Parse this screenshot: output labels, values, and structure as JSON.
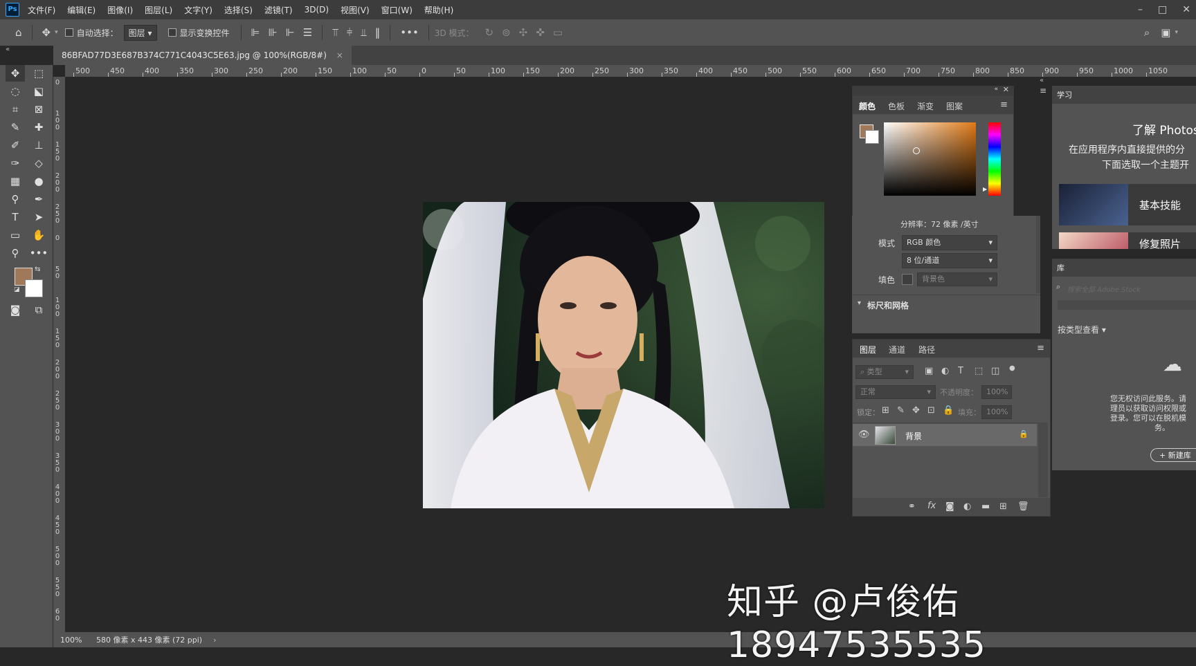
{
  "menubar": {
    "logo": "Ps",
    "items": [
      "文件(F)",
      "编辑(E)",
      "图像(I)",
      "图层(L)",
      "文字(Y)",
      "选择(S)",
      "滤镜(T)",
      "3D(D)",
      "视图(V)",
      "窗口(W)",
      "帮助(H)"
    ]
  },
  "options": {
    "auto_select_label": "自动选择：",
    "auto_select_value": "图层",
    "show_transform_label": "显示变换控件",
    "mode_3d_label": "3D 模式："
  },
  "document": {
    "tab_title": "86BFAD77D3E687B374C771C4043C5E63.jpg @ 100%(RGB/8#)",
    "tab_close": "×"
  },
  "ruler": {
    "h_labels": [
      "500",
      "450",
      "400",
      "350",
      "300",
      "250",
      "200",
      "150",
      "100",
      "50",
      "0",
      "50",
      "100",
      "150",
      "200",
      "250",
      "300",
      "350",
      "400",
      "450",
      "500",
      "550",
      "600",
      "650",
      "700",
      "750",
      "800",
      "850",
      "900",
      "950",
      "1000",
      "1050"
    ],
    "v_labels": [
      "0",
      "1 0 0",
      "1 5 0",
      "2 0 0",
      "2 5 0",
      "0",
      "5 0",
      "1 0 0",
      "1 5 0",
      "2 0 0",
      "2 5 0",
      "3 0 0",
      "3 5 0",
      "4 0 0",
      "4 5 0",
      "5 0 0",
      "5 5 0",
      "6 0"
    ]
  },
  "status": {
    "zoom": "100%",
    "info": "580 像素 x 443 像素 (72 ppi)",
    "arrow": "›"
  },
  "color_panel": {
    "tabs": [
      "颜色",
      "色板",
      "渐变",
      "图案"
    ],
    "fg_color": "#a0795a",
    "bg_color": "#ffffff"
  },
  "properties": {
    "resolution": "分辨率：72 像素 /英寸",
    "mode_label": "模式",
    "mode_value": "RGB 颜色",
    "depth_value": "8 位/通道",
    "fill_label": "填色",
    "fill_value": "背景色",
    "section_rulers": "标尺和网格"
  },
  "layers_panel": {
    "tabs": [
      "图层",
      "通道",
      "路径"
    ],
    "filter_placeholder": "类型",
    "blend_mode": "正常",
    "opacity_label": "不透明度：",
    "opacity_value": "100%",
    "lock_label": "锁定：",
    "fill_label": "填充：",
    "fill_value": "100%",
    "layer_name": "背景"
  },
  "learn_panel": {
    "tab": "学习",
    "title": "了解 Photos",
    "desc1": "在应用程序内直接提供的分",
    "desc2": "下面选取一个主题开",
    "card1": "基本技能",
    "card2": "修复照片"
  },
  "library_panel": {
    "tab": "库",
    "search_placeholder": "搜索全部 Adobe Stock",
    "view_by": "按类型查看",
    "msg1": "您无权访问此服务。请",
    "msg2": "理员以获取访问权限或",
    "msg3": "登录。您可以在脱机模",
    "msg4": "务。",
    "new_lib": "+ 新建库"
  },
  "watermark": "知乎 @卢俊佑18947535535",
  "colors": {
    "ui_dark": "#282828",
    "ui_panel": "#535353",
    "ui_bar": "#424242",
    "accent": "#31a8ff"
  }
}
